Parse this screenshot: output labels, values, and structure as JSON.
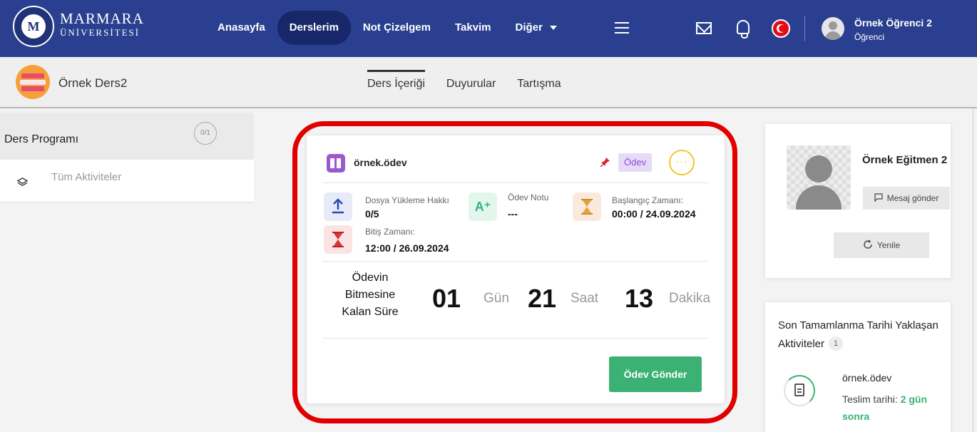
{
  "brand": {
    "line1": "MARMARA",
    "line2": "ÜNİVERSİTESİ",
    "logo_text": "M"
  },
  "nav": {
    "items": [
      {
        "label": "Anasayfa"
      },
      {
        "label": "Derslerim"
      },
      {
        "label": "Not Çizelgem"
      },
      {
        "label": "Takvim"
      },
      {
        "label": "Diğer"
      }
    ],
    "active": "Derslerim"
  },
  "user": {
    "name": "Örnek Öğrenci 2",
    "role": "Öğrenci"
  },
  "course": {
    "name": "Örnek Ders2"
  },
  "tabs": [
    {
      "label": "Ders İçeriği"
    },
    {
      "label": "Duyurular"
    },
    {
      "label": "Tartışma"
    }
  ],
  "sidebar": {
    "title": "Ders Programı",
    "count": "0/1",
    "item_label": "Tüm Aktiviteler"
  },
  "task": {
    "title": "örnek.ödev",
    "type_badge": "Ödev",
    "more_icon_text": "···",
    "upload_label": "Dosya Yükleme Hakkı",
    "upload_value": "0/5",
    "grade_label": "Ödev Notu",
    "grade_value": "---",
    "grade_icon_text": "A⁺",
    "start_label": "Başlangıç Zamanı:",
    "start_value": "00:00 / 24.09.2024",
    "end_label": "Bitiş Zamanı:",
    "end_value": "12:00 / 26.09.2024",
    "remaining_label_1": "Ödevin",
    "remaining_label_2": "Bitmesine",
    "remaining_label_3": "Kalan Süre",
    "days": "01",
    "days_unit": "Gün",
    "hours": "21",
    "hours_unit": "Saat",
    "minutes": "13",
    "minutes_unit": "Dakika",
    "submit_label": "Ödev Gönder"
  },
  "instructor": {
    "name": "Örnek Eğitmen 2",
    "message_label": "Mesaj gönder",
    "refresh_label": "Yenile"
  },
  "upcoming": {
    "title": "Son Tamamlanma Tarihi Yaklaşan Aktiviteler",
    "count": "1",
    "item_name": "örnek.ödev",
    "due_prefix": "Teslim tarihi:",
    "due_value": "2 gün sonra"
  },
  "colors": {
    "nav_bg": "#2a3f8f",
    "nav_active": "#18276a",
    "accent_green": "#3bb273",
    "badge_purple": "#8a4fd0",
    "highlight_red": "#e00000"
  }
}
